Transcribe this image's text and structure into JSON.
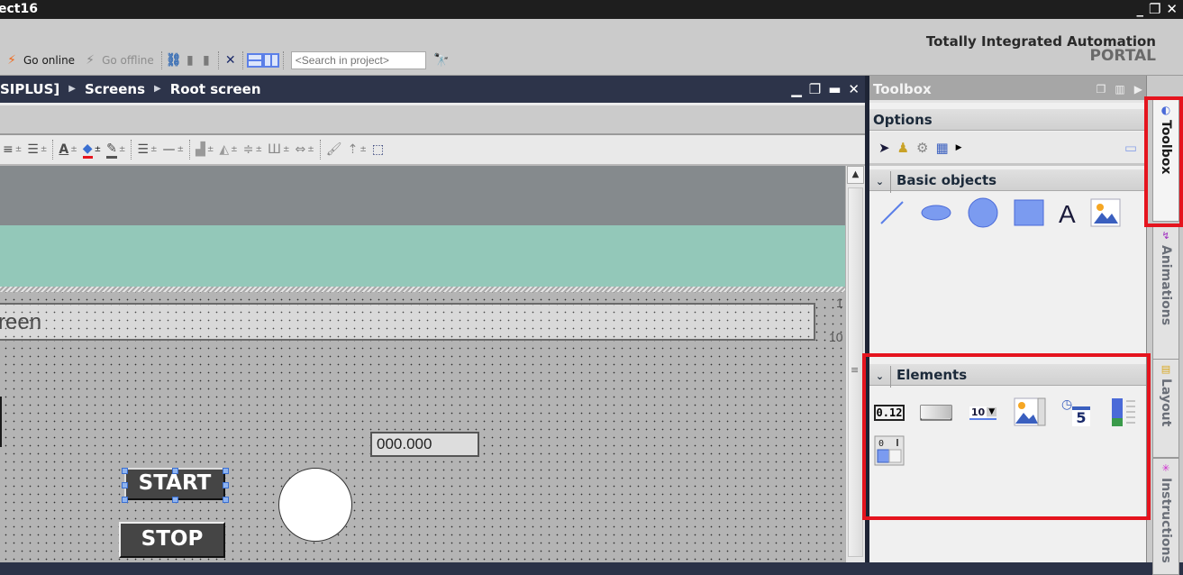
{
  "window": {
    "title": "ect16",
    "controls": {
      "minimize": "_",
      "restore": "❐",
      "close": "✕"
    }
  },
  "toolbar": {
    "go_online": "Go online",
    "go_offline": "Go offline",
    "search_placeholder": "<Search in project>",
    "icons": [
      "go-online-icon",
      "go-offline-icon",
      "accessible-devices-icon",
      "start-simulation-icon",
      "stop-simulation-icon",
      "cross-reference-icon",
      "split-horizontal-icon",
      "split-vertical-icon",
      "search-binoculars-icon"
    ]
  },
  "branding": {
    "line1": "Totally Integrated Automation",
    "line2": "PORTAL"
  },
  "editor": {
    "breadcrumb": [
      "SIPLUS]",
      "Screens",
      "Root screen"
    ],
    "breadcrumb_sep": "▶",
    "controls": {
      "minimize": "▁",
      "restore": "❐",
      "maximize": "▬",
      "close": "✕"
    }
  },
  "format_toolbar": {
    "tools": [
      "align-text-icon",
      "font-color-icon",
      "fill-color-icon",
      "line-color-icon",
      "line-width-icon",
      "line-style-icon",
      "arrange-icon",
      "rotate-icon",
      "align-icon",
      "distribute-icon",
      "same-size-icon",
      "format-painter-icon",
      "layer-icon",
      "zoom-selection-icon"
    ]
  },
  "canvas": {
    "screen_title_text": "reen",
    "ruler_marks": [
      "1",
      "10"
    ],
    "io_field_value": "000.000",
    "start_button_label": "START",
    "stop_button_label": "STOP"
  },
  "toolbox": {
    "title": "Toolbox",
    "options_label": "Options",
    "basic_objects_label": "Basic objects",
    "basic_objects": [
      "line",
      "ellipse",
      "circle",
      "rectangle",
      "text-field",
      "graphic-view"
    ],
    "text_field_glyph": "A",
    "elements_label": "Elements",
    "elements": [
      "io-field",
      "button",
      "symbolic-io-field",
      "graphic-io-field",
      "date-time-field",
      "bar",
      "switch"
    ],
    "io_field_glyph": "0.12",
    "symbolic_glyph": "10",
    "date_glyph": "5",
    "switch_glyph": "0  1"
  },
  "side_tabs": [
    {
      "label": "Toolbox",
      "active": true
    },
    {
      "label": "Animations",
      "active": false
    },
    {
      "label": "Layout",
      "active": false
    },
    {
      "label": "Instructions",
      "active": false
    }
  ],
  "colors": {
    "highlight": "#e5141e",
    "hmi_header": "#858a8d",
    "hmi_band": "#93c8b9",
    "accent_blue": "#5b7fe8"
  }
}
